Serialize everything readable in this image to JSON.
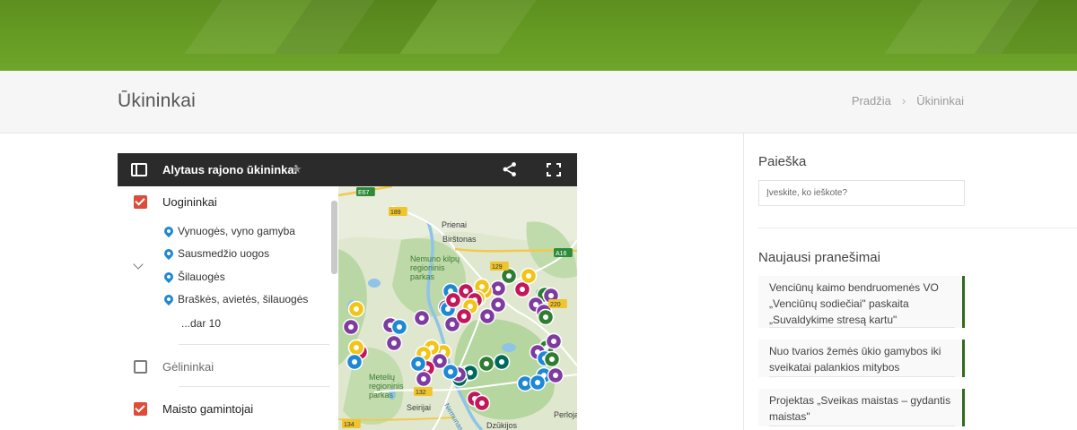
{
  "page": {
    "title": "Ūkininkai",
    "breadcrumb": [
      "Pradžia",
      "›",
      "Ūkininkai"
    ]
  },
  "map": {
    "title": "Alytaus rajono ūkininkai",
    "icons": {
      "legend_toggle": "legend-toggle-icon",
      "star": "star-icon",
      "share": "share-icon",
      "fullscreen": "fullscreen-icon"
    },
    "layers": [
      {
        "label": "Uogininkai",
        "checked": true,
        "items": [
          "Vynuogės, vyno gamyba",
          "Sausmedžio uogos",
          "Šilauogės",
          "Braškės, avietės, šilauogės"
        ],
        "more": "...dar 10"
      },
      {
        "label": "Gėlininkai",
        "checked": false
      },
      {
        "label": "Maisto gamintojai",
        "checked": true
      }
    ],
    "place_labels": [
      "E67",
      "189",
      "Prienai",
      "Birštonas",
      "A16",
      "Nemuno kilpų regioninis parkas",
      "129",
      "220",
      "Metelių regioninis parkas",
      "132",
      "Nemunas",
      "Seirijai",
      "Perloja",
      "134",
      "Dzūkijos"
    ],
    "marker_colors": {
      "purple": "#7e3ca0",
      "yellow": "#f2c417",
      "blue": "#1e88d4",
      "magenta": "#c2185b",
      "green": "#2e7d32",
      "teal": "#00695c"
    }
  },
  "sidebar": {
    "search": {
      "heading": "Paieška",
      "placeholder": "Įveskite, ko ieškote?"
    },
    "news": {
      "heading": "Naujausi pranešimai",
      "items": [
        "Venciūnų kaimo bendruomenės VO „Venciūnų sodiečiai\" paskaita „Suvaldykime stresą kartu\"",
        "Nuo tvarios žemės ūkio gamybos iki sveikatai palankios mitybos",
        "Projektas „Sveikas maistas – gydantis maistas\""
      ]
    }
  }
}
